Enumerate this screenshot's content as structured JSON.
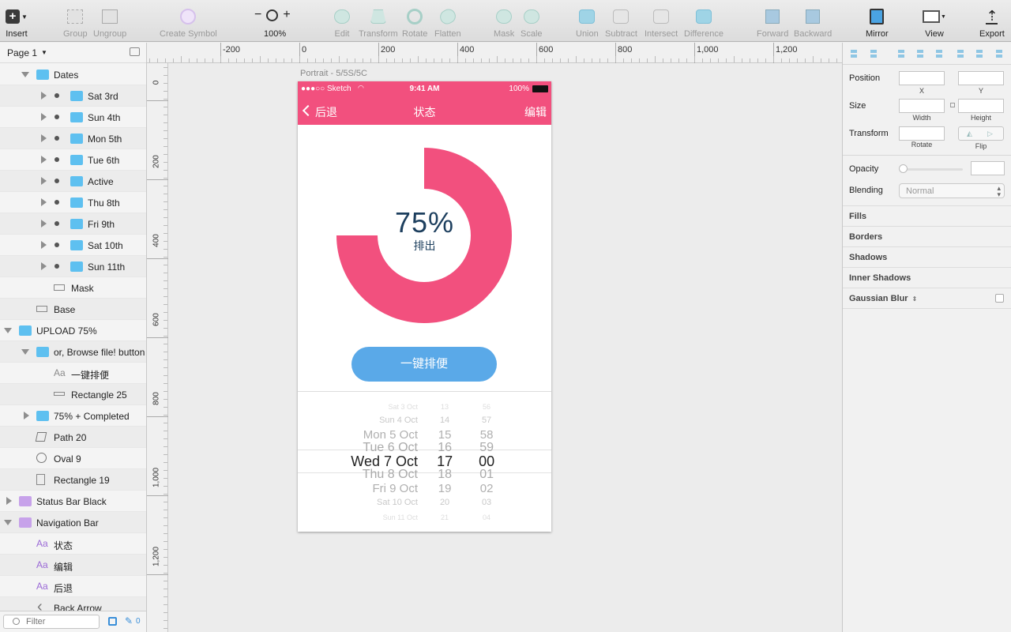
{
  "toolbar": {
    "insert": "Insert",
    "group": "Group",
    "ungroup": "Ungroup",
    "create_symbol": "Create Symbol",
    "zoom_minus": "−",
    "zoom_plus": "+",
    "zoom_level": "100%",
    "edit": "Edit",
    "transform": "Transform",
    "rotate": "Rotate",
    "flatten": "Flatten",
    "mask": "Mask",
    "scale": "Scale",
    "union": "Union",
    "subtract": "Subtract",
    "intersect": "Intersect",
    "difference": "Difference",
    "forward": "Forward",
    "backward": "Backward",
    "mirror": "Mirror",
    "view": "View",
    "export": "Export"
  },
  "left_panel": {
    "page_name": "Page 1",
    "filter_placeholder": "Filter",
    "filter_count": "0",
    "layers": [
      {
        "name": "Dates",
        "kind": "folder",
        "color": "blue",
        "indent": 1,
        "toggle": "down"
      },
      {
        "name": "Sat 3rd",
        "kind": "folder",
        "color": "blue",
        "indent": 2,
        "toggle": "right",
        "dot": true
      },
      {
        "name": "Sun 4th",
        "kind": "folder",
        "color": "blue",
        "indent": 2,
        "toggle": "right",
        "dot": true
      },
      {
        "name": "Mon 5th",
        "kind": "folder",
        "color": "blue",
        "indent": 2,
        "toggle": "right",
        "dot": true
      },
      {
        "name": "Tue 6th",
        "kind": "folder",
        "color": "blue",
        "indent": 2,
        "toggle": "right",
        "dot": true
      },
      {
        "name": "Active",
        "kind": "folder",
        "color": "blue",
        "indent": 2,
        "toggle": "right",
        "dot": true
      },
      {
        "name": "Thu 8th",
        "kind": "folder",
        "color": "blue",
        "indent": 2,
        "toggle": "right",
        "dot": true
      },
      {
        "name": "Fri 9th",
        "kind": "folder",
        "color": "blue",
        "indent": 2,
        "toggle": "right",
        "dot": true
      },
      {
        "name": "Sat 10th",
        "kind": "folder",
        "color": "blue",
        "indent": 2,
        "toggle": "right",
        "dot": true
      },
      {
        "name": "Sun 11th",
        "kind": "folder",
        "color": "blue",
        "indent": 2,
        "toggle": "right",
        "dot": true
      },
      {
        "name": "Mask",
        "kind": "rect",
        "indent": 2
      },
      {
        "name": "Base",
        "kind": "rect",
        "indent": 1
      },
      {
        "name": "UPLOAD 75%",
        "kind": "folder",
        "color": "blue",
        "indent": 0,
        "toggle": "down"
      },
      {
        "name": "or, Browse file! button",
        "kind": "folder",
        "color": "blue",
        "indent": 1,
        "toggle": "down"
      },
      {
        "name": "一键排便",
        "kind": "text",
        "indent": 2
      },
      {
        "name": "Rectangle 25",
        "kind": "rect-thin",
        "indent": 2
      },
      {
        "name": "75% + Completed",
        "kind": "folder",
        "color": "blue",
        "indent": 1,
        "toggle": "right"
      },
      {
        "name": "Path 20",
        "kind": "path",
        "indent": 1
      },
      {
        "name": "Oval 9",
        "kind": "oval",
        "indent": 1
      },
      {
        "name": "Rectangle 19",
        "kind": "rect-tall",
        "indent": 1
      },
      {
        "name": "Status Bar Black",
        "kind": "folder",
        "color": "purple",
        "indent": 0,
        "toggle": "right"
      },
      {
        "name": "Navigation Bar",
        "kind": "folder",
        "color": "purple",
        "indent": 0,
        "toggle": "down"
      },
      {
        "name": "状态",
        "kind": "text-purple",
        "indent": 1
      },
      {
        "name": "编辑",
        "kind": "text-purple",
        "indent": 1
      },
      {
        "name": "后退",
        "kind": "text-purple",
        "indent": 1
      },
      {
        "name": "Back Arrow",
        "kind": "arrow",
        "indent": 1
      }
    ]
  },
  "rulers": {
    "top": [
      "-200",
      "0",
      "200",
      "400",
      "600",
      "800",
      "1,000",
      "1,200"
    ],
    "left": [
      "0",
      "200",
      "400",
      "600",
      "800",
      "1,000",
      "1,200"
    ]
  },
  "artboard": {
    "label": "Portrait - 5/5S/5C",
    "status_carrier": "●●●○○ Sketch",
    "status_time": "9:41 AM",
    "status_battery": "100%",
    "nav_back": "后退",
    "nav_title": "状态",
    "nav_edit": "编辑",
    "progress_label": "75%",
    "progress_value": 0.75,
    "progress_sub": "排出",
    "action_button": "一键排便",
    "picker": {
      "dates": [
        "Sat 3 Oct",
        "Sun 4 Oct",
        "Mon 5 Oct",
        "Tue 6 Oct",
        "Wed 7 Oct",
        "Thu 8 Oct",
        "Fri 9 Oct",
        "Sat 10 Oct",
        "Sun 11 Oct"
      ],
      "hours": [
        "13",
        "14",
        "15",
        "16",
        "17",
        "18",
        "19",
        "20",
        "21"
      ],
      "minutes": [
        "56",
        "57",
        "58",
        "59",
        "00",
        "01",
        "02",
        "03",
        "04"
      ]
    }
  },
  "inspector": {
    "position": "Position",
    "x": "X",
    "y": "Y",
    "size": "Size",
    "width": "Width",
    "height": "Height",
    "transform": "Transform",
    "rotate": "Rotate",
    "flip": "Flip",
    "opacity": "Opacity",
    "blending": "Blending",
    "blending_value": "Normal",
    "sections": [
      "Fills",
      "Borders",
      "Shadows",
      "Inner Shadows",
      "Gaussian Blur"
    ]
  },
  "colors": {
    "accent_pink": "#f2507e",
    "button_blue": "#5aa9e8",
    "text_navy": "#1d3f5e",
    "folder_blue": "#5ec0f0",
    "folder_purple": "#c7a2ea"
  }
}
